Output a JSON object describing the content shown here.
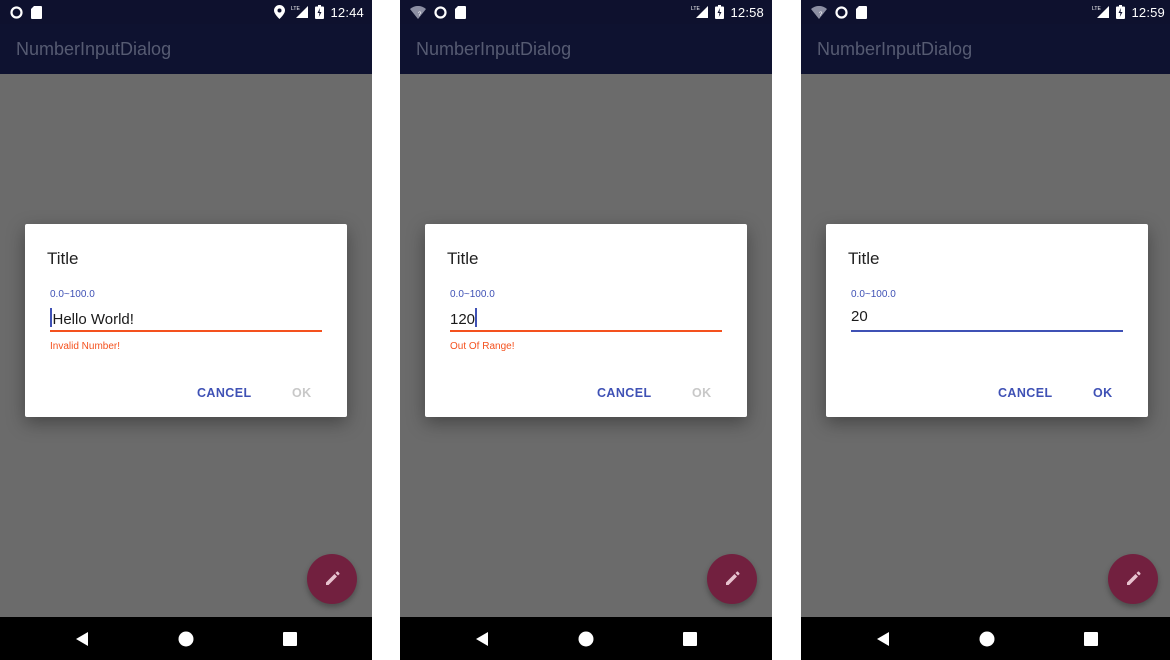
{
  "colors": {
    "accent": "#3f51b5",
    "error": "#f4511e",
    "disabled": "#c8c8c8",
    "primary_dark": "#0e112e",
    "fab": "#72203f",
    "scrim": "#6b6b6b"
  },
  "screens": [
    {
      "status_bar": {
        "time": "12:44",
        "left_icons": [
          "circle-icon",
          "sd-card-icon"
        ],
        "right_icons": [
          "location-pin-icon",
          "lte-signal-icon",
          "battery-charging-icon"
        ]
      },
      "app_bar": {
        "title": "NumberInputDialog"
      },
      "dialog": {
        "title": "Title",
        "hint": "0.0~100.0",
        "value": "Hello World!",
        "caret_position": "start",
        "state": "error",
        "error": "Invalid Number!",
        "buttons": {
          "cancel": "CANCEL",
          "ok": "OK",
          "ok_enabled": false
        }
      },
      "fab_icon": "pencil-icon",
      "nav_icons": [
        "back-icon",
        "home-icon",
        "recents-icon"
      ]
    },
    {
      "status_bar": {
        "time": "12:58",
        "left_icons": [
          "wifi-unknown-icon",
          "circle-icon",
          "sd-card-icon"
        ],
        "right_icons": [
          "lte-signal-icon",
          "battery-charging-icon"
        ]
      },
      "app_bar": {
        "title": "NumberInputDialog"
      },
      "dialog": {
        "title": "Title",
        "hint": "0.0~100.0",
        "value": "120",
        "caret_position": "end",
        "state": "error",
        "error": "Out Of Range!",
        "buttons": {
          "cancel": "CANCEL",
          "ok": "OK",
          "ok_enabled": false
        }
      },
      "fab_icon": "pencil-icon",
      "nav_icons": [
        "back-icon",
        "home-icon",
        "recents-icon"
      ]
    },
    {
      "status_bar": {
        "time": "12:59",
        "left_icons": [
          "wifi-unknown-icon",
          "circle-icon",
          "sd-card-icon"
        ],
        "right_icons": [
          "lte-signal-icon",
          "battery-charging-icon"
        ]
      },
      "app_bar": {
        "title": "NumberInputDialog"
      },
      "dialog": {
        "title": "Title",
        "hint": "0.0~100.0",
        "value": "20",
        "caret_position": "none",
        "state": "valid",
        "error": "",
        "buttons": {
          "cancel": "CANCEL",
          "ok": "OK",
          "ok_enabled": true
        }
      },
      "fab_icon": "pencil-icon",
      "nav_icons": [
        "back-icon",
        "home-icon",
        "recents-icon"
      ]
    }
  ]
}
